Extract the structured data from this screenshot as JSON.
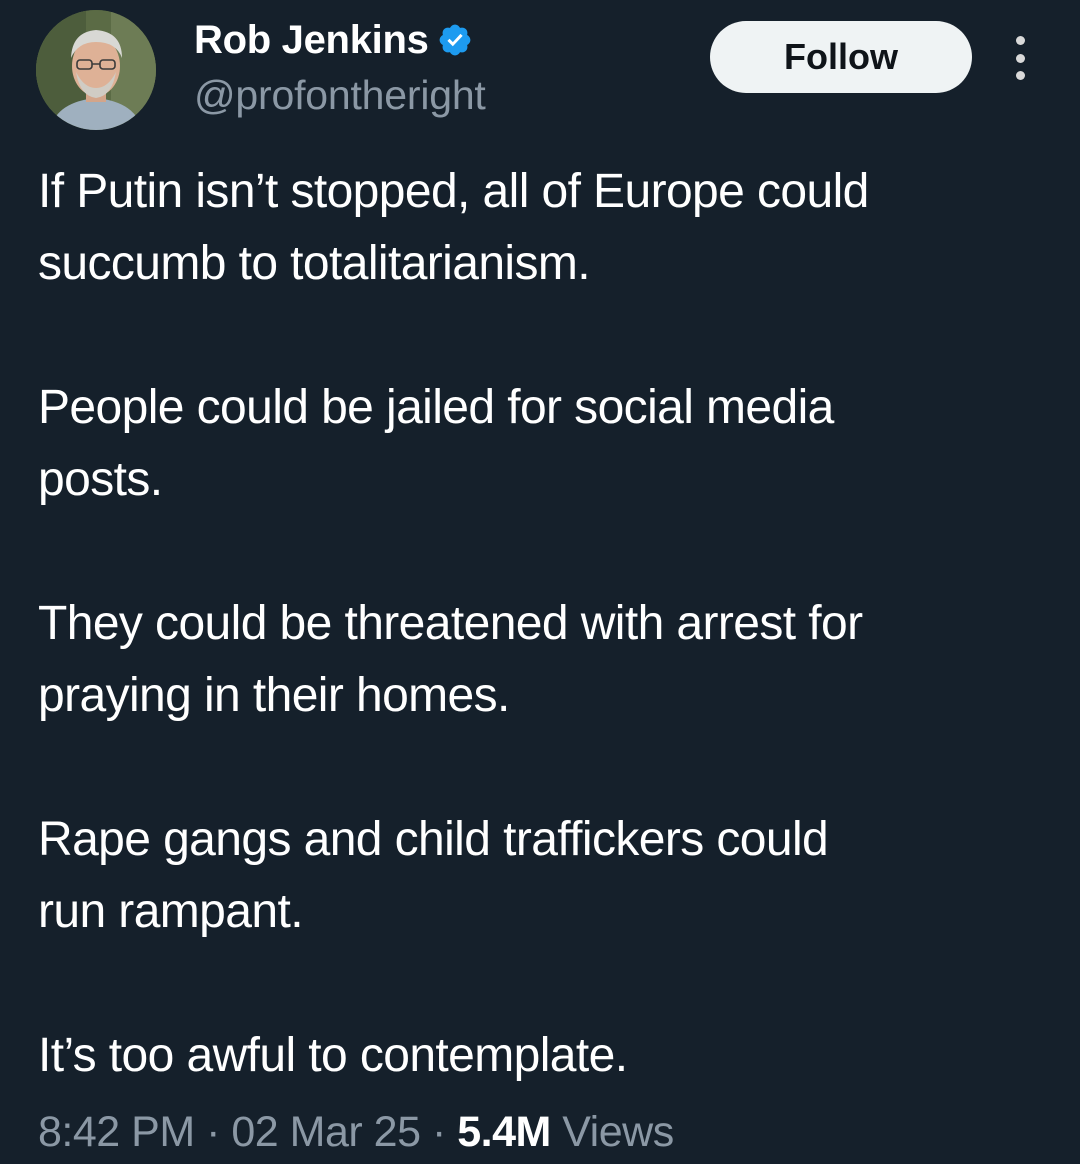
{
  "author": {
    "display_name": "Rob Jenkins",
    "handle": "@profontheright",
    "verified_color": "#1d9bf0"
  },
  "header": {
    "follow_label": "Follow",
    "more_icon": "more-vertical-icon"
  },
  "tweet": {
    "paragraphs": [
      "If Putin isn’t stopped, all of Europe could\nsuccumb to totalitarianism.",
      "People could be jailed for social media\nposts.",
      "They could be threatened with arrest for\npraying in their homes.",
      "Rape gangs and child traffickers could\nrun rampant.",
      "It’s too awful to contemplate."
    ]
  },
  "meta": {
    "time": "8:42 PM",
    "separator": "·",
    "date": "02 Mar 25",
    "views_count": "5.4M",
    "views_label": "Views"
  },
  "colors": {
    "background": "#15202b",
    "text_primary": "#ffffff",
    "text_secondary": "#8b98a5",
    "button_bg": "#eff3f4"
  }
}
